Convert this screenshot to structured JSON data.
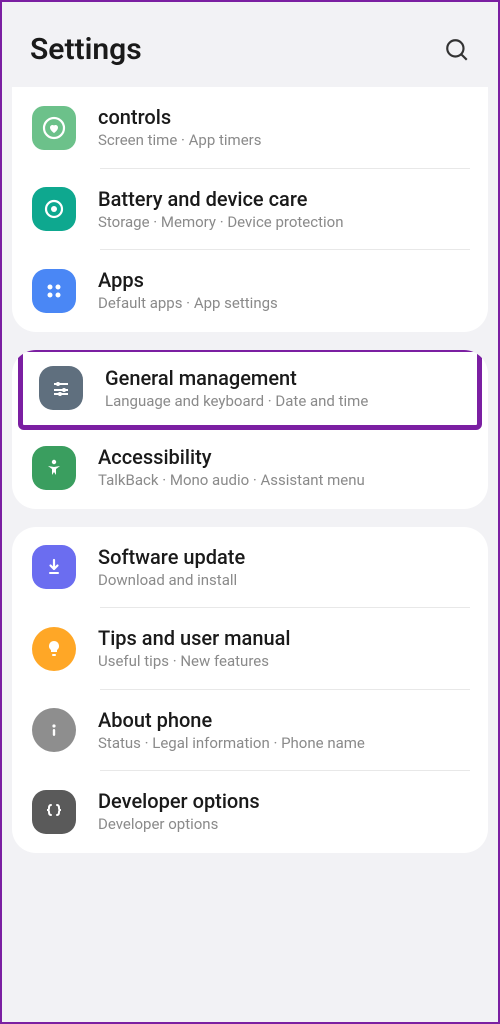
{
  "header": {
    "title": "Settings"
  },
  "groups": [
    {
      "items": [
        {
          "key": "controls",
          "title": "controls",
          "sub": "Screen time  ·  App timers",
          "icon": "heart-circle",
          "color": "ic-green1"
        },
        {
          "key": "battery",
          "title": "Battery and device care",
          "sub": "Storage  ·  Memory  ·  Device protection",
          "icon": "care",
          "color": "ic-teal"
        },
        {
          "key": "apps",
          "title": "Apps",
          "sub": "Default apps  ·  App settings",
          "icon": "grid4",
          "color": "ic-blue"
        }
      ]
    },
    {
      "items": [
        {
          "key": "general",
          "title": "General management",
          "sub": "Language and keyboard  ·  Date and time",
          "icon": "sliders",
          "color": "ic-slate",
          "highlighted": true
        },
        {
          "key": "accessibility",
          "title": "Accessibility",
          "sub": "TalkBack  ·  Mono audio  ·  Assistant menu",
          "icon": "person",
          "color": "ic-green2"
        }
      ]
    },
    {
      "items": [
        {
          "key": "software",
          "title": "Software update",
          "sub": "Download and install",
          "icon": "download",
          "color": "ic-purple"
        },
        {
          "key": "tips",
          "title": "Tips and user manual",
          "sub": "Useful tips  ·  New features",
          "icon": "bulb",
          "color": "ic-orange"
        },
        {
          "key": "about",
          "title": "About phone",
          "sub": "Status  ·  Legal information  ·  Phone name",
          "icon": "info",
          "color": "ic-gray"
        },
        {
          "key": "developer",
          "title": "Developer options",
          "sub": "Developer options",
          "icon": "braces",
          "color": "ic-dark"
        }
      ]
    }
  ]
}
